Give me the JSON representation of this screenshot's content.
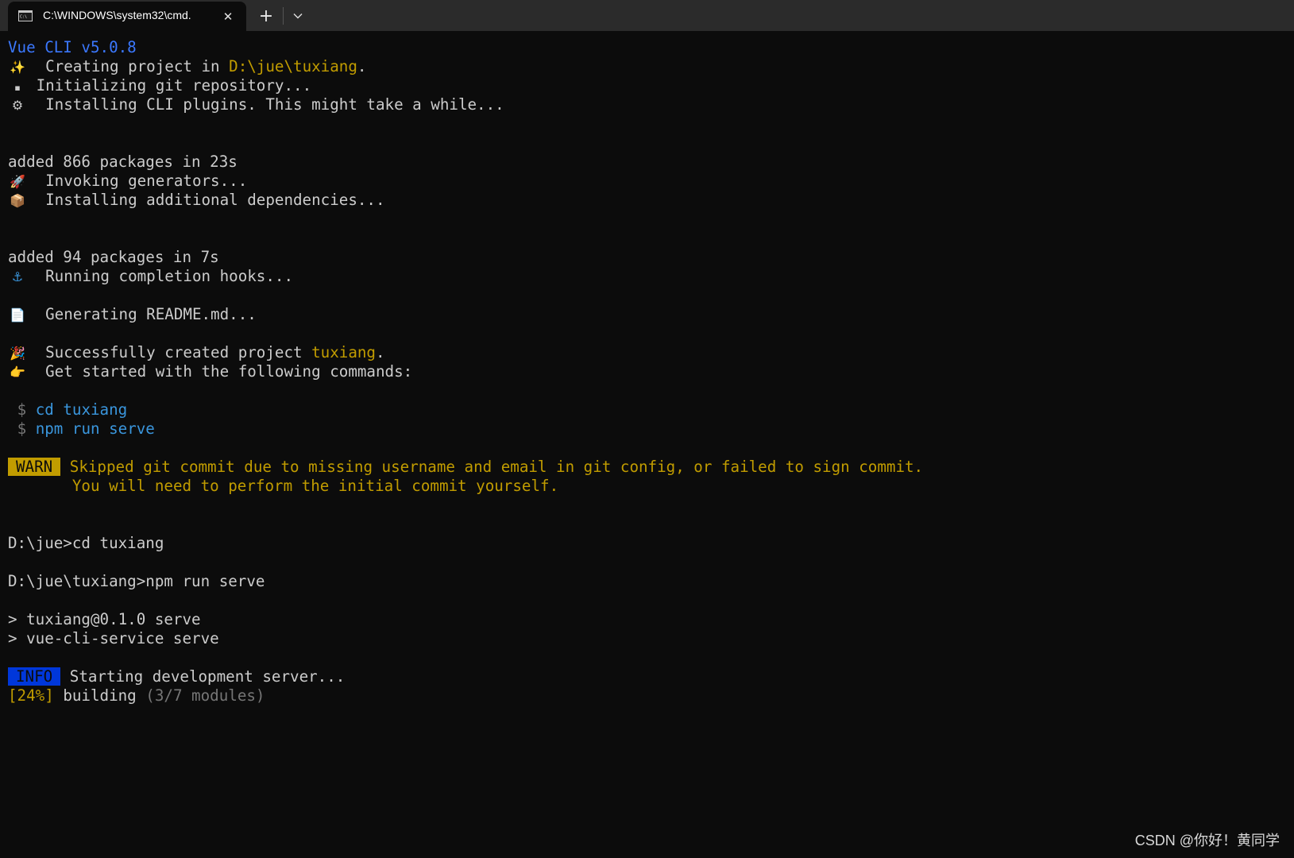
{
  "window": {
    "tab_title": "C:\\WINDOWS\\system32\\cmd.",
    "tab_close_glyph": "✕",
    "new_tab_glyph": "+"
  },
  "terminal": {
    "vue_header": "Vue CLI v5.0.8",
    "creating_prefix": "Creating project in ",
    "creating_path": "D:\\jue\\tuxiang",
    "creating_suffix": ".",
    "init_git": "Initializing git repository...",
    "installing_plugins": "Installing CLI plugins. This might take a while...",
    "added_866": "added 866 packages in 23s",
    "invoking": "Invoking generators...",
    "installing_deps": "Installing additional dependencies...",
    "added_94": "added 94 packages in 7s",
    "running_hooks": "Running completion hooks...",
    "generating_readme": "Generating README.md...",
    "success_prefix": "Successfully created project ",
    "success_project": "tuxiang",
    "success_suffix": ".",
    "get_started": "Get started with the following commands:",
    "cmd_prompt": "$",
    "cmd_cd": "cd tuxiang",
    "cmd_serve": "npm run serve",
    "warn_label": "WARN",
    "warn_line1": "Skipped git commit due to missing username and email in git config, or failed to sign commit.",
    "warn_line2": "You will need to perform the initial commit yourself.",
    "prompt_cd": "D:\\jue>cd tuxiang",
    "prompt_serve": "D:\\jue\\tuxiang>npm run serve",
    "script_line1": "> tuxiang@0.1.0 serve",
    "script_line2": "> vue-cli-service serve",
    "info_label": "INFO",
    "info_text": "Starting development server...",
    "progress_percent": "[24%]",
    "progress_text": " building ",
    "progress_modules": "(3/7 modules)"
  },
  "icons": {
    "sparkles": "✨",
    "git": "▪",
    "gear": "⚙",
    "rocket": "🚀",
    "package": "📦",
    "anchor": "⚓",
    "document": "📄",
    "party": "🎉",
    "pointing": "👉"
  },
  "watermark": "CSDN @你好！黄同学",
  "colors": {
    "background": "#0c0c0c",
    "text": "#cccccc",
    "blue": "#3b78ff",
    "cyan": "#3a96dd",
    "yellow": "#c19c00",
    "info_bg": "#0037da"
  }
}
